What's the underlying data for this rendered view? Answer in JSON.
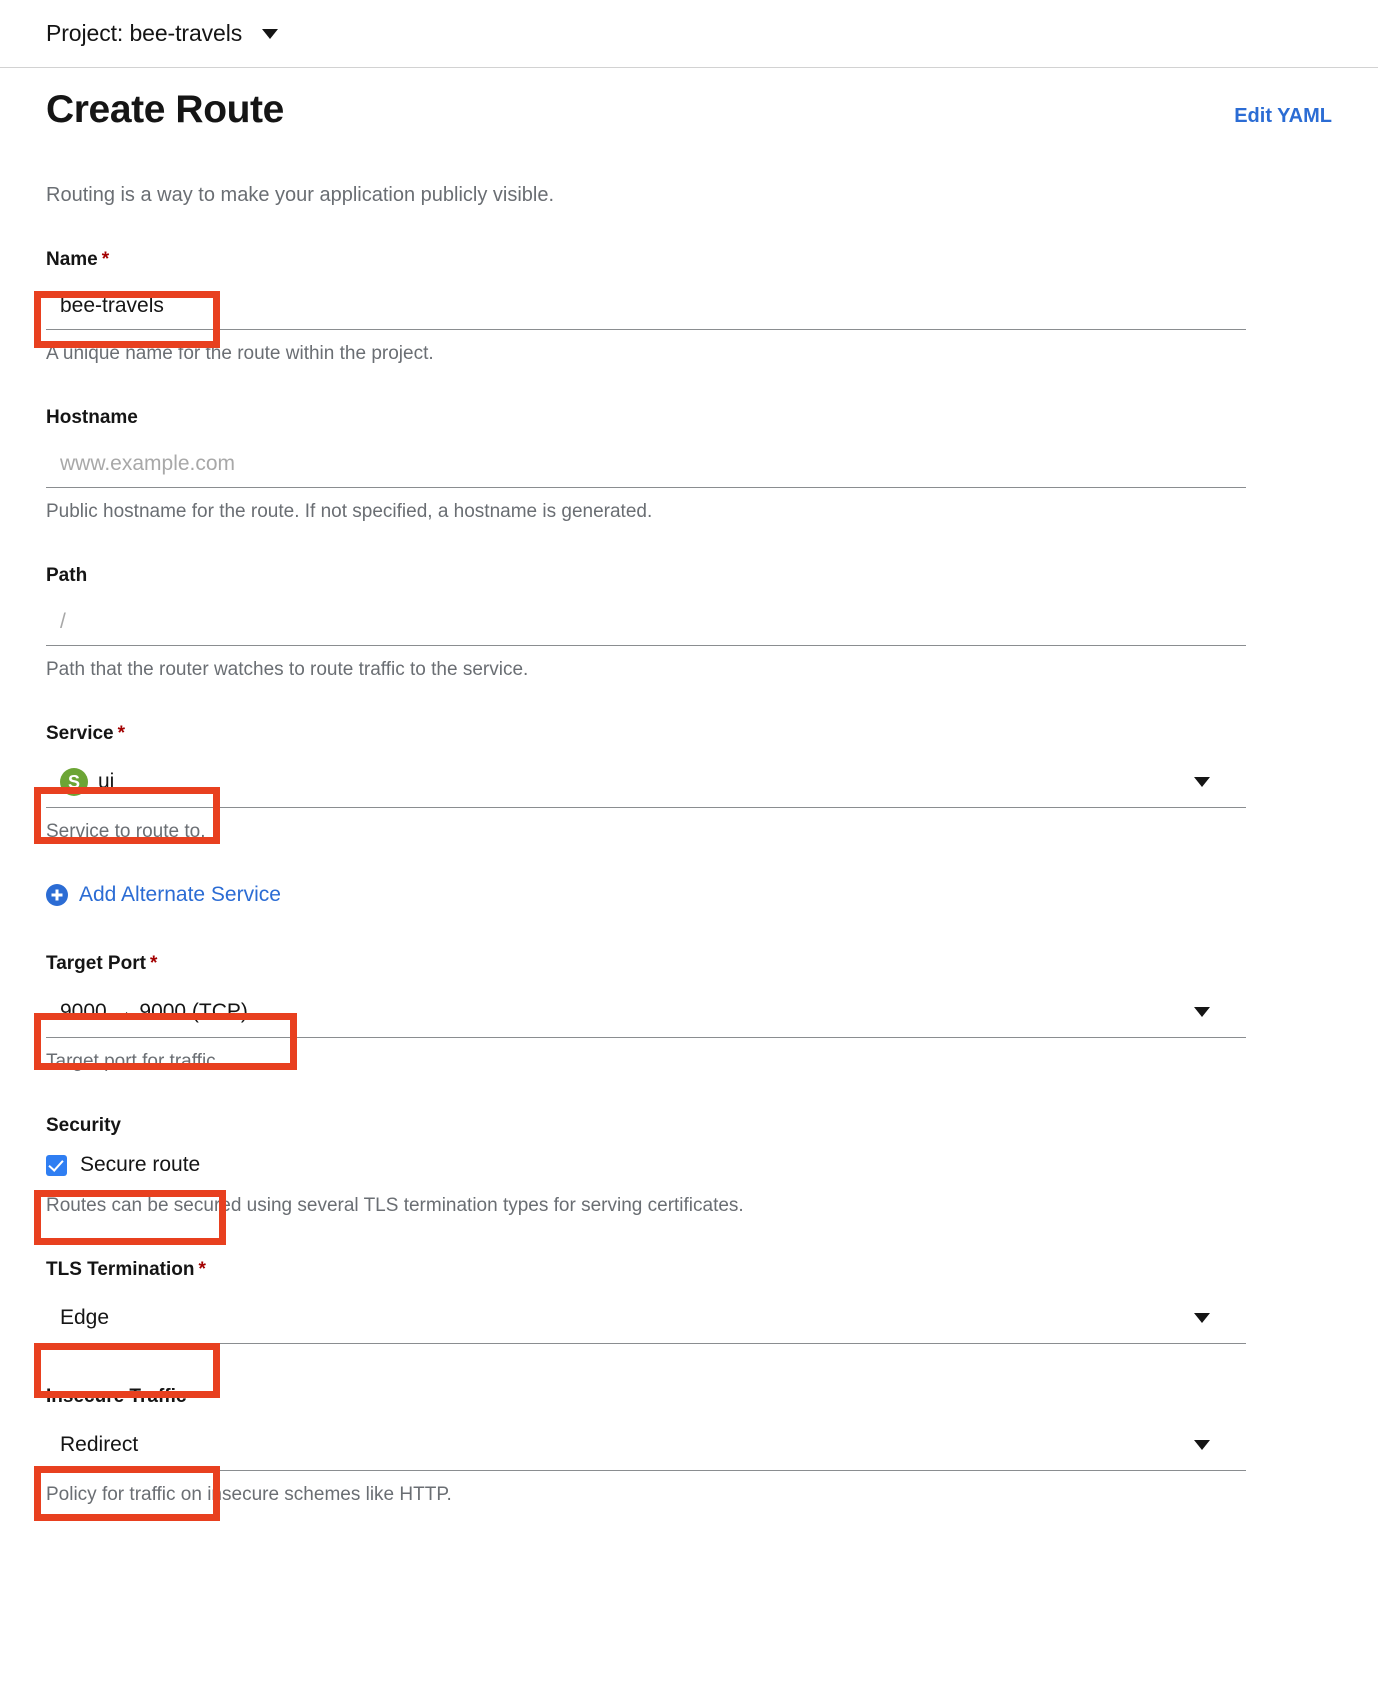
{
  "project_bar": {
    "label": "Project: bee-travels",
    "caret_icon": "chevron-down-icon"
  },
  "header": {
    "title": "Create Route",
    "edit_yaml_label": "Edit YAML"
  },
  "intro": "Routing is a way to make your application publicly visible.",
  "form": {
    "name": {
      "label": "Name",
      "required_marker": "*",
      "value": "bee-travels",
      "placeholder": "",
      "helper": "A unique name for the route within the project."
    },
    "hostname": {
      "label": "Hostname",
      "value": "",
      "placeholder": "www.example.com",
      "helper": "Public hostname for the route. If not specified, a hostname is generated."
    },
    "path": {
      "label": "Path",
      "value": "",
      "placeholder": "/",
      "helper": "Path that the router watches to route traffic to the service."
    },
    "service": {
      "label": "Service",
      "required_marker": "*",
      "badge_letter": "S",
      "badge_color": "#6ca535",
      "value": "ui",
      "helper": "Service to route to.",
      "caret_icon": "chevron-down-icon"
    },
    "add_alternate_service": {
      "label": "Add Alternate Service",
      "icon": "plus-circle-icon"
    },
    "target_port": {
      "label": "Target Port",
      "required_marker": "*",
      "value": "9000 → 9000 (TCP)",
      "helper": "Target port for traffic.",
      "caret_icon": "chevron-down-icon"
    },
    "security": {
      "label": "Security",
      "checkbox_label": "Secure route",
      "checked": true,
      "helper": "Routes can be secured using several TLS termination types for serving certificates."
    },
    "tls_termination": {
      "label": "TLS Termination",
      "required_marker": "*",
      "value": "Edge",
      "caret_icon": "chevron-down-icon"
    },
    "insecure_traffic": {
      "label": "Insecure Traffic",
      "value": "Redirect",
      "helper": "Policy for traffic on insecure schemes like HTTP.",
      "caret_icon": "chevron-down-icon"
    }
  },
  "annotation": {
    "color": "#e8401f"
  }
}
